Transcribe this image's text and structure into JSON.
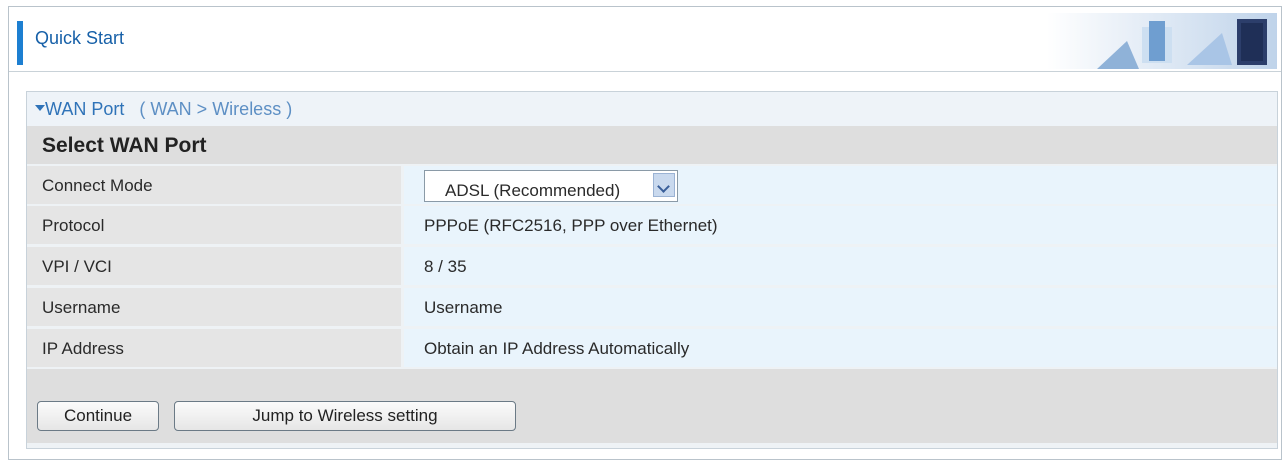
{
  "header": {
    "title": "Quick Start"
  },
  "breadcrumb": {
    "section": "WAN Port",
    "path": "( WAN > Wireless )"
  },
  "form": {
    "title": "Select WAN Port",
    "rows": [
      {
        "label": "Connect Mode",
        "value": "ADSL  (Recommended)"
      },
      {
        "label": "Protocol",
        "value": "PPPoE (RFC2516, PPP over Ethernet)"
      },
      {
        "label": "VPI / VCI",
        "value": "8 / 35"
      },
      {
        "label": "Username",
        "value": "Username"
      },
      {
        "label": "IP Address",
        "value": "Obtain an IP Address Automatically"
      }
    ]
  },
  "buttons": {
    "continue": "Continue",
    "jump": "Jump to Wireless setting"
  }
}
